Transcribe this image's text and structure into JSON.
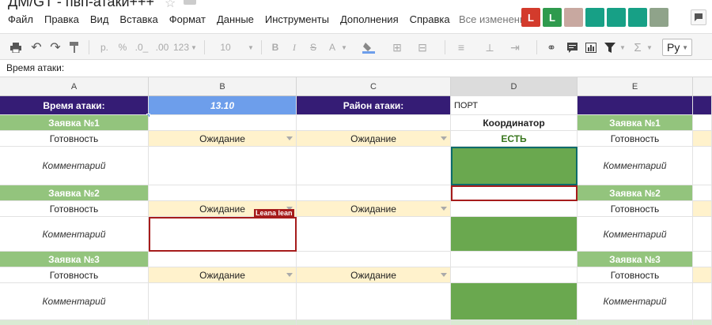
{
  "app": {
    "doc_title": "ДМ/GT - пвп-атаки+++",
    "saved_status": "Все изменени",
    "menu": [
      "Файл",
      "Правка",
      "Вид",
      "Вставка",
      "Формат",
      "Данные",
      "Инструменты",
      "Дополнения",
      "Справка"
    ],
    "collaborators": [
      {
        "letter": "L",
        "color": "#d33b2c",
        "icon": "avatar-letter"
      },
      {
        "letter": "L",
        "color": "#2f9a4d",
        "icon": "avatar-letter"
      },
      {
        "letter": "",
        "color": "#c8a8a0",
        "icon": "avatar-photo"
      },
      {
        "letter": "",
        "color": "#17a086",
        "icon": "bird-icon"
      },
      {
        "letter": "",
        "color": "#17a086",
        "icon": "hand-icon"
      },
      {
        "letter": "",
        "color": "#17a086",
        "icon": "wolf-icon"
      },
      {
        "letter": "",
        "color": "#8fa38a",
        "icon": "avatar-photo"
      }
    ]
  },
  "toolbar": {
    "currency": "р.",
    "percent": "%",
    "dec_decrease": ".0_",
    "dec_increase": ".00",
    "format_more": "123",
    "font_size": "10",
    "bold": "B",
    "italic": "I",
    "strike": "S",
    "text_color": "A",
    "input_lang": "Ру"
  },
  "formula_bar": {
    "content": "Время атаки:"
  },
  "columns": [
    "A",
    "B",
    "C",
    "D",
    "E"
  ],
  "selected_column": "D",
  "rows": {
    "r1": {
      "a": "Время атаки:",
      "b": "13.10",
      "c": "Район атаки:",
      "d": "ПОРТ",
      "e": ""
    },
    "r2": {
      "a": "Заявка №1",
      "d": "Координатор",
      "e": "Заявка №1"
    },
    "r3": {
      "a": "Готовность",
      "b": "Ожидание",
      "c": "Ожидание",
      "d": "ЕСТЬ",
      "e": "Готовность"
    },
    "r4": {
      "a": "Комментарий",
      "e": "Комментарий"
    },
    "r5": {
      "a": "Заявка №2",
      "e": "Заявка №2"
    },
    "r6": {
      "a": "Готовность",
      "b": "Ожидание",
      "c": "Ожидание",
      "e": "Готовность"
    },
    "r7": {
      "a": "Комментарий",
      "e": "Комментарий"
    },
    "r8": {
      "a": "Заявка №3",
      "e": "Заявка №3"
    },
    "r9": {
      "a": "Готовность",
      "b": "Ожидание",
      "c": "Ожидание",
      "e": "Готовность"
    },
    "r10": {
      "a": "Комментарий",
      "e": "Комментарий"
    }
  },
  "cell_note_label": "Leana lean",
  "colors": {
    "purple": "#351c75",
    "blue": "#6d9eeb",
    "light_green": "#93c47d",
    "dark_green": "#6aa84f",
    "yellow": "#fff2cc",
    "selection_red": "#a61c1c"
  }
}
